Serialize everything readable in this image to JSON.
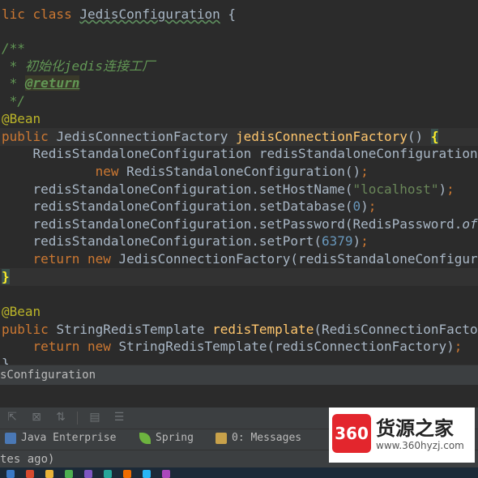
{
  "editor": {
    "lines": [
      {
        "segs": [
          {
            "c": "kw",
            "t": "lic class "
          },
          {
            "c": "",
            "t": "JedisConfiguration"
          },
          {
            "c": "",
            "t": " {"
          }
        ]
      },
      {
        "segs": [
          {
            "c": "",
            "t": ""
          }
        ]
      },
      {
        "segs": [
          {
            "c": "cmt",
            "t": "/**"
          }
        ]
      },
      {
        "segs": [
          {
            "c": "cmt",
            "t": " * 初始化jedis连接工厂"
          }
        ]
      },
      {
        "segs": [
          {
            "c": "cmt",
            "t": " * "
          },
          {
            "c": "tag",
            "t": "@return"
          }
        ]
      },
      {
        "segs": [
          {
            "c": "cmt",
            "t": " */"
          }
        ]
      },
      {
        "segs": [
          {
            "c": "ann",
            "t": "@Bean"
          }
        ]
      },
      {
        "segs": [
          {
            "c": "kw",
            "t": "public "
          },
          {
            "c": "",
            "t": "JedisConnectionFactory "
          },
          {
            "c": "fn",
            "t": "jedisConnectionFactory"
          },
          {
            "c": "",
            "t": "() "
          },
          {
            "c": "brace-hl",
            "t": "{"
          }
        ]
      },
      {
        "segs": [
          {
            "c": "",
            "t": "    RedisStandaloneConfiguration redisStandaloneConfiguration ="
          }
        ]
      },
      {
        "segs": [
          {
            "c": "",
            "t": "            "
          },
          {
            "c": "kw",
            "t": "new "
          },
          {
            "c": "",
            "t": "RedisStandaloneConfiguration()"
          },
          {
            "c": "kw",
            "t": ";"
          }
        ]
      },
      {
        "segs": [
          {
            "c": "",
            "t": "    redisStandaloneConfiguration.setHostName("
          },
          {
            "c": "str",
            "t": "\"localhost\""
          },
          {
            "c": "",
            "t": ")"
          },
          {
            "c": "kw",
            "t": ";"
          }
        ]
      },
      {
        "segs": [
          {
            "c": "",
            "t": "    redisStandaloneConfiguration.setDatabase("
          },
          {
            "c": "num",
            "t": "0"
          },
          {
            "c": "",
            "t": ")"
          },
          {
            "c": "kw",
            "t": ";"
          }
        ]
      },
      {
        "segs": [
          {
            "c": "",
            "t": "    redisStandaloneConfiguration.setPassword(RedisPassword."
          },
          {
            "c": "italic",
            "t": "of"
          }
        ]
      },
      {
        "segs": [
          {
            "c": "",
            "t": "    redisStandaloneConfiguration.setPort("
          },
          {
            "c": "num",
            "t": "6379"
          },
          {
            "c": "",
            "t": ")"
          },
          {
            "c": "kw",
            "t": ";"
          }
        ]
      },
      {
        "segs": [
          {
            "c": "kw",
            "t": "    return new "
          },
          {
            "c": "",
            "t": "JedisConnectionFactory(redisStandaloneConfiguration)"
          }
        ]
      },
      {
        "segs": [
          {
            "c": "brace-hl",
            "t": "}"
          }
        ]
      },
      {
        "segs": [
          {
            "c": "",
            "t": ""
          }
        ]
      },
      {
        "segs": [
          {
            "c": "ann",
            "t": "@Bean"
          }
        ]
      },
      {
        "segs": [
          {
            "c": "kw",
            "t": "public "
          },
          {
            "c": "",
            "t": "StringRedisTemplate "
          },
          {
            "c": "fn",
            "t": "redisTemplate"
          },
          {
            "c": "",
            "t": "(RedisConnectionFactory"
          }
        ]
      },
      {
        "segs": [
          {
            "c": "kw",
            "t": "    return new "
          },
          {
            "c": "",
            "t": "StringRedisTemplate(redisConnectionFactory)"
          },
          {
            "c": "kw",
            "t": ";"
          }
        ]
      },
      {
        "segs": [
          {
            "c": "",
            "t": "}"
          }
        ]
      }
    ]
  },
  "breadcrumb": {
    "text": "sConfiguration"
  },
  "toolbar": {
    "icons": [
      "export-icon",
      "close-tool-icon",
      "sort-icon",
      "layout-icon",
      "filter-icon"
    ]
  },
  "tabs": [
    {
      "label": "Java Enterprise",
      "icon": "java-enterprise-icon",
      "color": "#4a78b5"
    },
    {
      "label": "Spring",
      "icon": "spring-leaf-icon",
      "color": "#6db33f"
    },
    {
      "label": "0: Messages",
      "icon": "messages-icon",
      "color": "#c8a14a"
    }
  ],
  "status": {
    "text": "tes ago)"
  },
  "logo": {
    "badge": "360",
    "name": "货源之家",
    "url": "www.360hyzj.com"
  },
  "colors": {
    "keyword": "#cc7832",
    "function": "#ffc66d",
    "string": "#6a8759",
    "number": "#6897bb",
    "annotation": "#bbb529",
    "comment": "#629755",
    "background": "#2b2b2b"
  }
}
